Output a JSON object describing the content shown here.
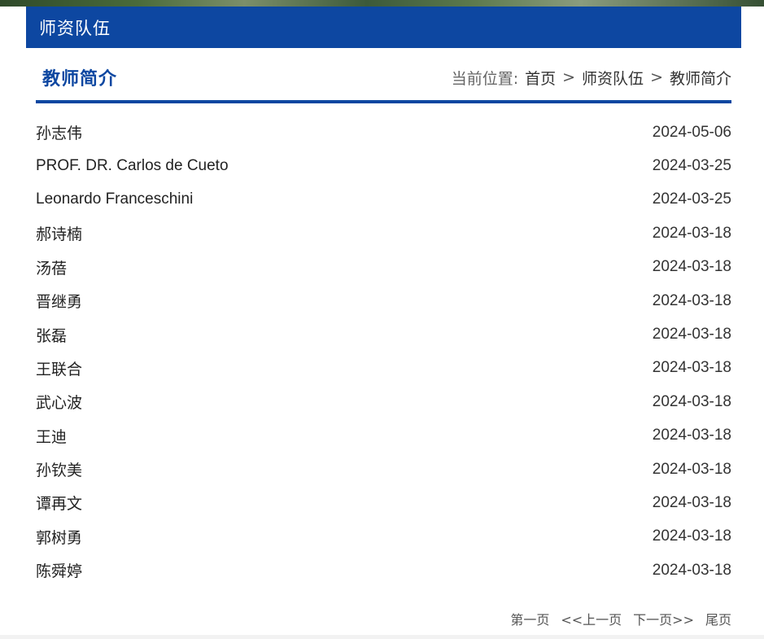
{
  "section": {
    "title": "师资队伍"
  },
  "header": {
    "page_title": "教师简介",
    "breadcrumb": {
      "label": "当前位置:",
      "items": [
        "首页",
        "师资队伍",
        "教师简介"
      ],
      "separator": ">"
    }
  },
  "list": {
    "items": [
      {
        "name": "孙志伟",
        "date": "2024-05-06"
      },
      {
        "name": "PROF. DR. Carlos de Cueto",
        "date": "2024-03-25"
      },
      {
        "name": "Leonardo Franceschini",
        "date": "2024-03-25"
      },
      {
        "name": "郝诗楠",
        "date": "2024-03-18"
      },
      {
        "name": "汤蓓",
        "date": "2024-03-18"
      },
      {
        "name": "晋继勇",
        "date": "2024-03-18"
      },
      {
        "name": "张磊",
        "date": "2024-03-18"
      },
      {
        "name": "王联合",
        "date": "2024-03-18"
      },
      {
        "name": "武心波",
        "date": "2024-03-18"
      },
      {
        "name": "王迪",
        "date": "2024-03-18"
      },
      {
        "name": "孙钦美",
        "date": "2024-03-18"
      },
      {
        "name": "谭再文",
        "date": "2024-03-18"
      },
      {
        "name": "郭树勇",
        "date": "2024-03-18"
      },
      {
        "name": "陈舜婷",
        "date": "2024-03-18"
      }
    ]
  },
  "pagination": {
    "first": "第一页",
    "prev": "<<上一页",
    "next": "下一页>>",
    "last": "尾页"
  },
  "colors": {
    "brand_blue": "#0d47a1"
  }
}
